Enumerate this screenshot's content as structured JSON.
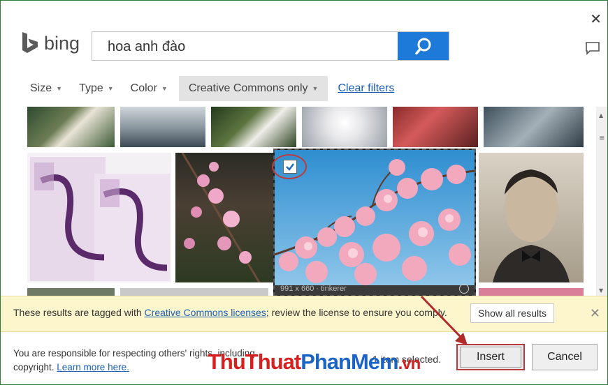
{
  "dialog": {
    "close_glyph": "✕"
  },
  "brand": {
    "name": "bing"
  },
  "search": {
    "query": "hoa anh đào",
    "button_icon": "search-icon"
  },
  "filters": {
    "size": "Size",
    "type": "Type",
    "color": "Color",
    "license": "Creative Commons only",
    "clear": "Clear filters"
  },
  "results": {
    "selected_image_caption": "991 x 660 · tinkerer"
  },
  "notification": {
    "text_before": "These results are tagged with ",
    "link": "Creative Commons licenses",
    "text_after": "; review the license to ensure you comply.",
    "show_all": "Show all results",
    "close_glyph": "✕"
  },
  "footer": {
    "notice_line1": "You are responsible for respecting others' rights, including",
    "notice_line2": "copyright. ",
    "learn_more": "Learn more here.",
    "selected_count": "1 item selected.",
    "insert": "Insert",
    "cancel": "Cancel"
  },
  "watermark": {
    "part1": "ThuThuat",
    "part2": "PhanMem",
    "part3": ".vn"
  },
  "colors": {
    "accent": "#1e7ad8",
    "link": "#1a5fb4",
    "notification_bg": "#fdf6cc",
    "highlight_red": "#b73a3a",
    "dialog_border": "#2f7a3a"
  }
}
